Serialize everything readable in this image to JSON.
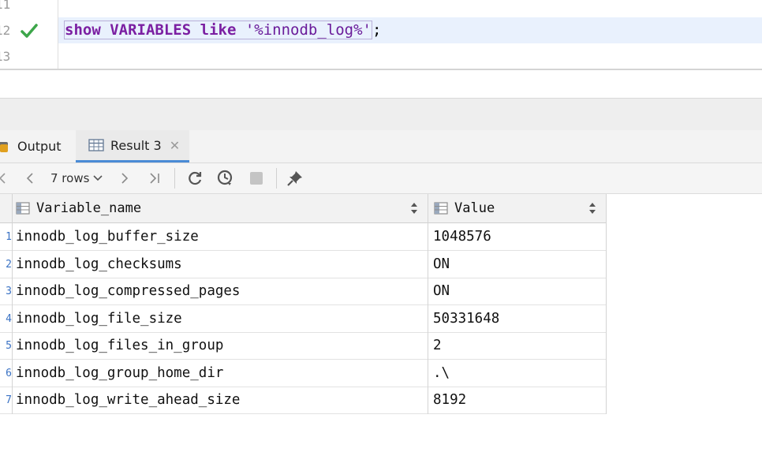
{
  "editor": {
    "line_numbers": [
      "11",
      "12",
      "13"
    ],
    "sql_keyword_show": "show",
    "sql_keyword_variables": "VARIABLES",
    "sql_keyword_like": "like",
    "sql_string": "'%innodb_log%'",
    "sql_terminator": ";",
    "executed_status": "success-check-icon",
    "highlight_color": "#e9f1fd"
  },
  "tabs": [
    {
      "label": "Output",
      "icon": "output-icon",
      "active": false
    },
    {
      "label": "Result 3",
      "icon": "table-icon",
      "active": true,
      "closable": true
    }
  ],
  "toolbar": {
    "rows_label": "7 rows",
    "buttons": [
      "first-page-icon",
      "prev-page-icon",
      "next-page-icon",
      "last-page-icon",
      "refresh-icon",
      "history-icon",
      "stop-icon",
      "pin-icon"
    ]
  },
  "grid": {
    "columns": [
      "Variable_name",
      "Value"
    ],
    "rows": [
      {
        "num": "1",
        "name": "innodb_log_buffer_size",
        "value": "1048576"
      },
      {
        "num": "2",
        "name": "innodb_log_checksums",
        "value": "ON"
      },
      {
        "num": "3",
        "name": "innodb_log_compressed_pages",
        "value": "ON"
      },
      {
        "num": "4",
        "name": "innodb_log_file_size",
        "value": "50331648"
      },
      {
        "num": "5",
        "name": "innodb_log_files_in_group",
        "value": "2"
      },
      {
        "num": "6",
        "name": "innodb_log_group_home_dir",
        "value": ".\\"
      },
      {
        "num": "7",
        "name": "innodb_log_write_ahead_size",
        "value": "8192"
      }
    ]
  },
  "colors": {
    "keyword": "#7b1fa2",
    "check": "#3da64a",
    "active_tab_underline": "#4a8bd6",
    "row_number": "#3a72c4"
  }
}
